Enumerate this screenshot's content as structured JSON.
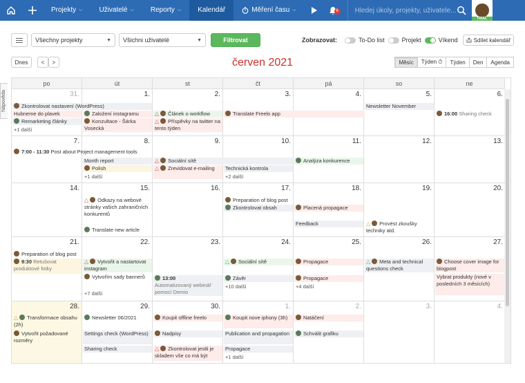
{
  "topbar": {
    "nav": [
      {
        "label": "Projekty",
        "chevron": true,
        "active": false
      },
      {
        "label": "Uživatelé",
        "chevron": true,
        "active": false
      },
      {
        "label": "Reporty",
        "chevron": true,
        "active": false
      },
      {
        "label": "Kalendář",
        "chevron": false,
        "active": true
      },
      {
        "label": "Měření času",
        "chevron": true,
        "active": false
      }
    ],
    "notification_count": "6",
    "search_placeholder": "Hledej úkoly, projekty, uživatele...",
    "trial_label": "TRIAL"
  },
  "toolbar": {
    "project_select": "Všechny projekty",
    "user_select": "Všichni uživatelé",
    "filter_button": "Filtrovat",
    "show_label": "Zobrazovat:",
    "toggles": [
      {
        "label": "To-Do list",
        "on": false
      },
      {
        "label": "Projekt",
        "on": false
      },
      {
        "label": "Víkend",
        "on": true
      }
    ],
    "share_button": "Sdílet kalendář"
  },
  "side_tab": "Nápověda",
  "calendar": {
    "today_button": "Dnes",
    "prev": "<",
    "next": ">",
    "title": "červen 2021",
    "views": [
      {
        "label": "Měsíc",
        "selected": true
      },
      {
        "label": "Týden ⏱",
        "selected": false
      },
      {
        "label": "Týden",
        "selected": false
      },
      {
        "label": "Den",
        "selected": false
      },
      {
        "label": "Agenda",
        "selected": false
      }
    ],
    "weekdays": [
      "po",
      "út",
      "st",
      "čt",
      "pá",
      "so",
      "ne"
    ],
    "weeks": [
      {
        "days": [
          "31.",
          "1.",
          "2.",
          "3.",
          "4.",
          "5.",
          "6."
        ]
      },
      {
        "days": [
          "7.",
          "8.",
          "9.",
          "10.",
          "11.",
          "12.",
          "13."
        ]
      },
      {
        "days": [
          "14.",
          "15.",
          "16.",
          "17.",
          "18.",
          "19.",
          "20."
        ]
      },
      {
        "days": [
          "21.",
          "22.",
          "23.",
          "24.",
          "25.",
          "26.",
          "27."
        ]
      },
      {
        "days": [
          "28.",
          "29.",
          "30.",
          "1.",
          "2.",
          "3.",
          "4."
        ]
      }
    ],
    "events": {
      "w1_span": "Zkontrolovat nastavení (WordPress)",
      "w1_d1_a": "Hubneme do plavek",
      "w1_d1_b": "Remarketing články",
      "w1_d1_more": "+1 další",
      "w1_d2_a": "Založení instagramu",
      "w1_d2_b": "Konzultace - Šárka Vosecká",
      "w1_d3_a": "Článek o workflow",
      "w1_d3_b": "Příspěvky na twitter na tento týden",
      "w1_d4_a": "Translate Freelo app",
      "w1_d6_a": "Newsletter November",
      "w1_d7_time": "16:00",
      "w1_d7_a": "Sharing check",
      "w2_span_time": "7:00 - 11:30",
      "w2_span": "Post about Project management tools",
      "w2_d1_a": "Month report",
      "w2_d1_b": "Polish",
      "w2_d1_more": "+1 další",
      "w2_d3_a": "Sociální sítě",
      "w2_d3_b": "Zrevidovat e-mailing",
      "w2_d4_a": "Technická kontrola",
      "w2_d4_more": "+2 další",
      "w2_d5_a": "Analýza konkurence",
      "w3_d2_a": "Odkazy na webové stránky vašich zahraničních konkurentů",
      "w3_d2_b": "Translate new article",
      "w3_span": "Preparation of blog post",
      "w3_d4_b": "Zkontrolovat obsah",
      "w3_d5_a": "Placená propagace",
      "w3_d5_b": "Feedback",
      "w3_d6_a": "Provést zkoušky techniky atd.",
      "w4_span": "Preparation of blog post",
      "w4_d1_time": "9:30",
      "w4_d1_a": "Retušovat produktové fotky",
      "w4_d2_a": "Vytvořit a nastartovat instagram",
      "w4_d2_b": "Vytvořím sady bannerů",
      "w4_d2_more": "+7 další",
      "w4_d3_time": "13:00",
      "w4_d3_a": "Automatizovaný webinář pomocí Demio",
      "w4_d4_a": "Sociální sítě",
      "w4_d4_b": "Závěr",
      "w4_d4_more": "+10 další",
      "w4_d5_a": "Propagace",
      "w4_d5_b": "Propagace",
      "w4_d5_more": "+4 další",
      "w4_d6_a": "Meta and technical questions check",
      "w4_d7_a": "Choose cover image for blogpost",
      "w4_d7_b": "Vybrat produkty (nové v posledních 3 měsících)",
      "w5_d1_a": "Transformace obsahu (2h)",
      "w5_d1_b": "Vytvořit požadované rozměry",
      "w5_d2_a": "Newsletter 06/2021",
      "w5_d2_b": "Settings check (WordPress)",
      "w5_d2_c": "Sharing check",
      "w5_d3_a": "Koupit offline freelo",
      "w5_d3_b": "Nadpisy",
      "w5_d3_c": "Zkontrolovat jestli je skladem vše co má být",
      "w5_d4_a": "Koupit nove iphony (3h)",
      "w5_d4_b": "Publication and propagation",
      "w5_d4_c": "Propagace",
      "w5_d4_more": "+1 další",
      "w5_d5_a": "Natáčení",
      "w5_d5_b": "Schválit grafiku"
    }
  }
}
